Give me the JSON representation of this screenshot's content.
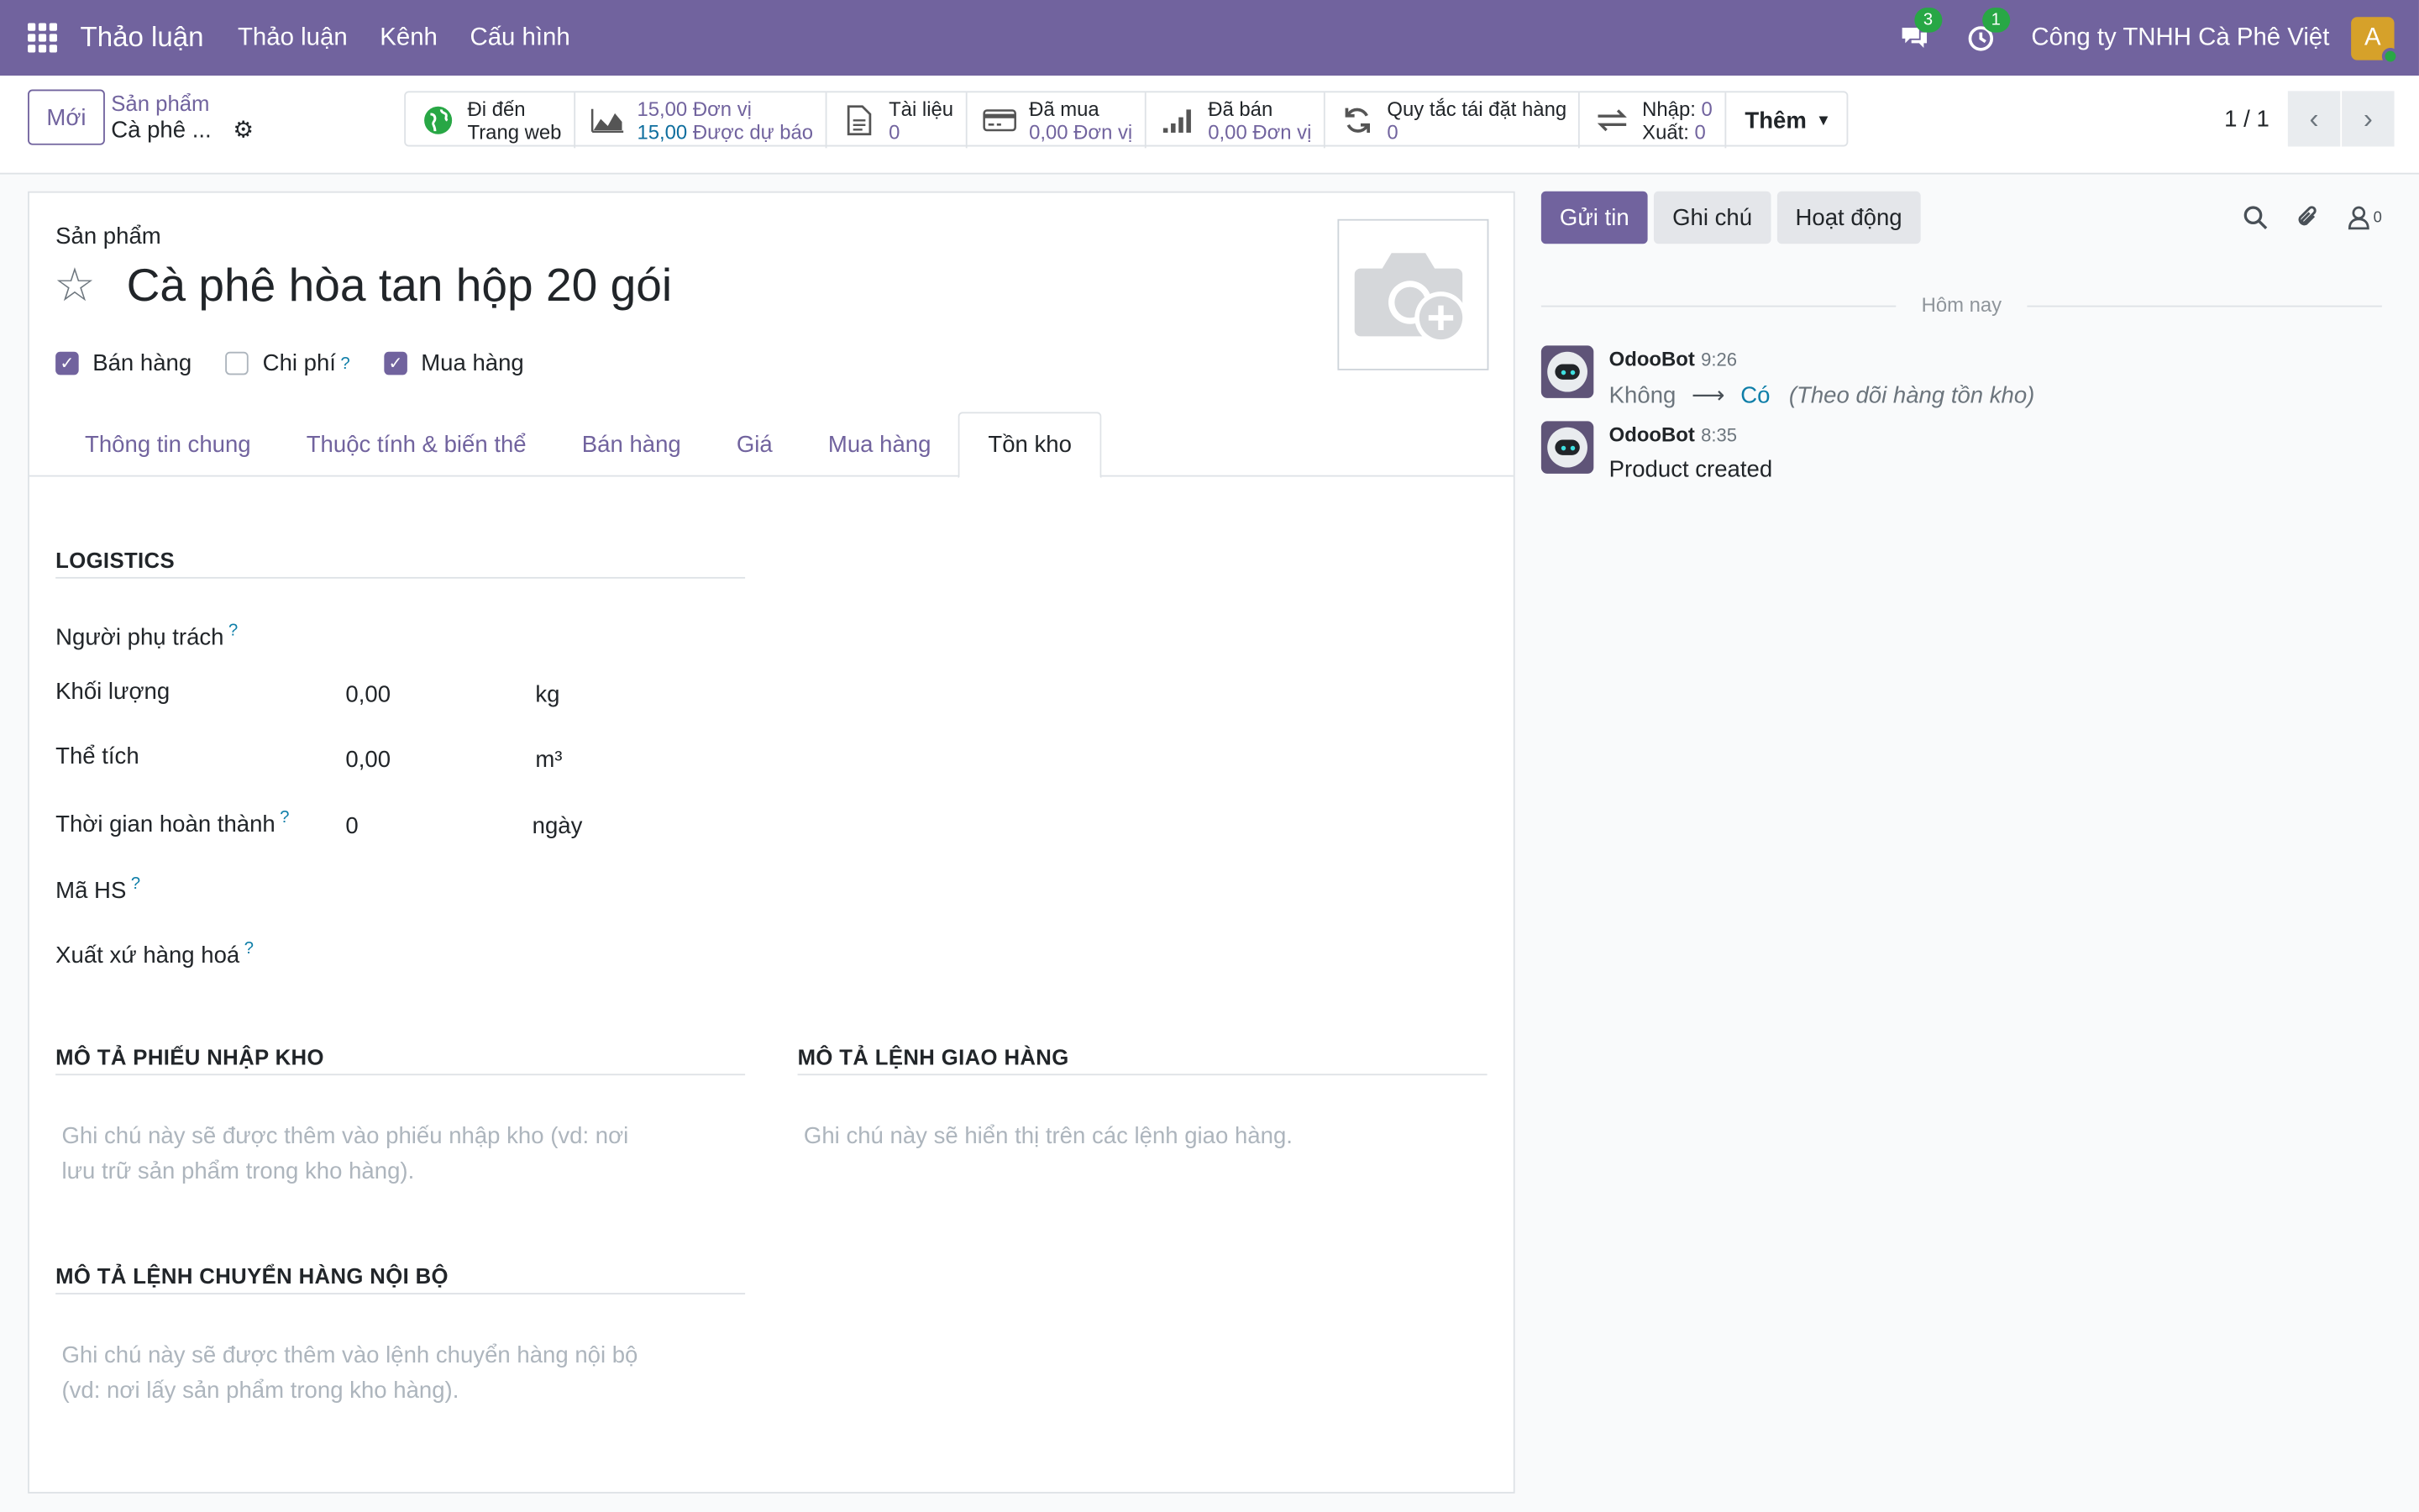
{
  "navbar": {
    "app_name": "Thảo luận",
    "menu": [
      "Thảo luận",
      "Kênh",
      "Cấu hình"
    ],
    "messages_count": "3",
    "activities_count": "1",
    "company": "Công ty TNHH Cà Phê Việt",
    "avatar_letter": "A"
  },
  "control": {
    "new_label": "Mới",
    "breadcrumb_parent": "Sản phẩm",
    "breadcrumb_current": "Cà phê ...",
    "pager": "1 / 1",
    "more_label": "Thêm",
    "stats": [
      {
        "line1": "Đi đến",
        "line2": "Trang web",
        "icon": "globe-icon"
      },
      {
        "line1_val": "15,00",
        "line1_unit": "Đơn vị",
        "line2_val": "15,00",
        "line2_unit": "Được dự báo",
        "icon": "area-chart-icon"
      },
      {
        "line1": "Tài liệu",
        "line2": "0",
        "icon": "file-icon"
      },
      {
        "line1": "Đã mua",
        "line2": "0,00 Đơn vị",
        "icon": "credit-card-icon"
      },
      {
        "line1": "Đã bán",
        "line2": "0,00 Đơn vị",
        "icon": "signal-icon"
      },
      {
        "line1": "Quy tắc tái đặt hàng",
        "line2": "0",
        "icon": "refresh-icon"
      },
      {
        "in_label": "Nhập:",
        "in_val": "0",
        "out_label": "Xuất:",
        "out_val": "0",
        "icon": "exchange-icon"
      }
    ]
  },
  "form": {
    "label": "Sản phẩm",
    "title": "Cà phê hòa tan hộp 20 gói",
    "checkboxes": [
      {
        "label": "Bán hàng",
        "checked": true
      },
      {
        "label": "Chi phí",
        "checked": false,
        "help": "?"
      },
      {
        "label": "Mua hàng",
        "checked": true
      }
    ],
    "tabs": [
      "Thông tin chung",
      "Thuộc tính & biến thể",
      "Bán hàng",
      "Giá",
      "Mua hàng",
      "Tồn kho"
    ],
    "active_tab": "Tồn kho",
    "logistics": {
      "title": "LOGISTICS",
      "responsible_label": "Người phụ trách",
      "weight_label": "Khối lượng",
      "weight_val": "0,00",
      "weight_unit": "kg",
      "volume_label": "Thể tích",
      "volume_val": "0,00",
      "volume_unit": "m³",
      "lead_label": "Thời gian hoàn thành",
      "lead_val": "0",
      "lead_unit": "ngày",
      "hs_label": "Mã HS",
      "origin_label": "Xuất xứ hàng hoá",
      "help": "?"
    },
    "receipt": {
      "title": "MÔ TẢ PHIẾU NHẬP KHO",
      "placeholder_l1": "Ghi chú này sẽ được thêm vào phiếu nhập kho (vd: nơi",
      "placeholder_l2": "lưu trữ sản phẩm trong kho hàng)."
    },
    "delivery": {
      "title": "MÔ TẢ LỆNH GIAO HÀNG",
      "placeholder": "Ghi chú này sẽ hiển thị trên các lệnh giao hàng."
    },
    "internal": {
      "title": "MÔ TẢ LỆNH CHUYỂN HÀNG NỘI BỘ",
      "placeholder_l1": "Ghi chú này sẽ được thêm vào lệnh chuyển hàng nội bộ",
      "placeholder_l2": "(vd: nơi lấy sản phẩm trong kho hàng)."
    }
  },
  "chatter": {
    "send_label": "Gửi tin",
    "note_label": "Ghi chú",
    "activity_label": "Hoạt động",
    "followers_count": "0",
    "today_label": "Hôm nay",
    "messages": [
      {
        "author": "OdooBot",
        "time": "9:26",
        "old": "Không",
        "new": "Có",
        "field": "(Theo dõi hàng tồn kho)"
      },
      {
        "author": "OdooBot",
        "time": "8:35",
        "text": "Product created"
      }
    ]
  }
}
